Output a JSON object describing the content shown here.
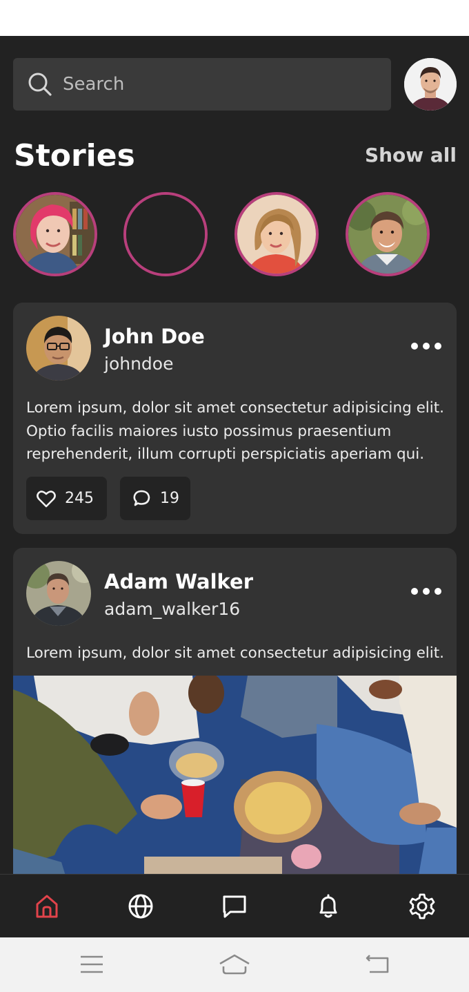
{
  "search": {
    "placeholder": "Search",
    "icon": "search-icon"
  },
  "stories": {
    "title": "Stories",
    "show_all_label": "Show all",
    "accent_color": "#b83f7c",
    "items": [
      {
        "name": "story-1",
        "has_photo": true
      },
      {
        "name": "story-2",
        "has_photo": false
      },
      {
        "name": "story-3",
        "has_photo": true
      },
      {
        "name": "story-4",
        "has_photo": true
      }
    ]
  },
  "posts": [
    {
      "author_name": "John Doe",
      "author_handle": "johndoe",
      "text": "Lorem ipsum, dolor sit amet consectetur adipisicing elit. Optio facilis maiores iusto possimus praesentium reprehenderit, illum corrupti perspiciatis aperiam qui.",
      "likes": "245",
      "comments": "19"
    },
    {
      "author_name": "Adam Walker",
      "author_handle": "adam_walker16",
      "text": "Lorem ipsum, dolor sit amet consectetur adipisicing elit.",
      "has_image": true
    }
  ],
  "bottom_nav": {
    "active_color": "#e2434b",
    "items": [
      "home-icon",
      "globe-icon",
      "chat-icon",
      "bell-icon",
      "gear-icon"
    ],
    "active": "home-icon"
  },
  "system_nav": {
    "items": [
      "menu-icon",
      "home-icon",
      "back-icon"
    ]
  }
}
